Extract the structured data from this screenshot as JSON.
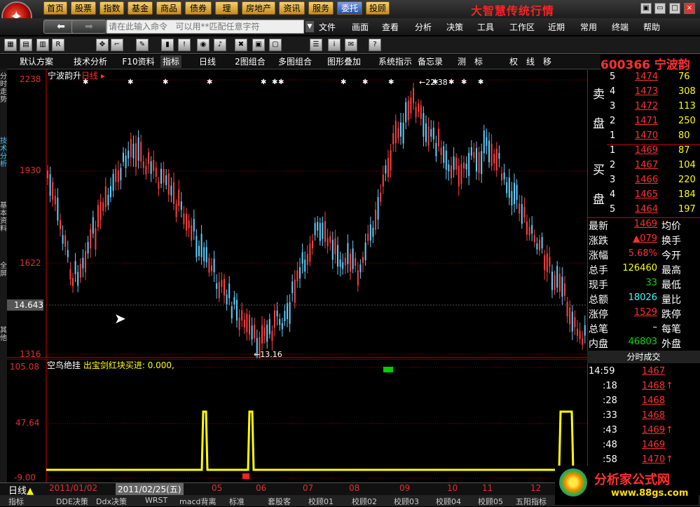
{
  "app": {
    "title": "大智慧传统行情",
    "nav": [
      "首页",
      "股票",
      "指数",
      "基金",
      "商品",
      "债券",
      "理财",
      "房地产",
      "资讯",
      "服务",
      "委托",
      "投顾"
    ],
    "command_placeholder": "请在此输入命令   可以用**匹配任意字符",
    "menus": [
      "文件",
      "画面",
      "查看",
      "分析",
      "决策",
      "工具",
      "工作区",
      "近期",
      "常用",
      "终端",
      "帮助"
    ]
  },
  "tabs": [
    "默认方案",
    "技术分析",
    "F10资料",
    "指标",
    "日线",
    "2图组合",
    "多图组合",
    "图形叠加",
    "系统指示",
    "备忘录",
    "测",
    "标",
    "权",
    "线",
    "移"
  ],
  "left_tabs": [
    "分时走势",
    "技术分析",
    "基本资料",
    "全屏",
    "其他"
  ],
  "stock": {
    "code": "600366",
    "name": "宁波韵升",
    "period": "日线"
  },
  "main_chart": {
    "y_labels": [
      "2238",
      "1930",
      "1622",
      "14.643",
      "1316"
    ],
    "annotations": {
      "high": "22.38",
      "low": "13.16"
    }
  },
  "indicator": {
    "name": "空鸟绝挂",
    "text": "出宝剑红块买进: 0.000,",
    "y_labels": [
      "105.08",
      "47.64",
      "-9.00"
    ]
  },
  "x_axis": {
    "start": "2011/01/02",
    "cursor": "2011/02/25(五)",
    "months": [
      "05",
      "06",
      "07",
      "08",
      "09",
      "10",
      "11",
      "12"
    ]
  },
  "order_book": {
    "sell_label": [
      "卖",
      "盘"
    ],
    "buy_label": [
      "买",
      "盘"
    ],
    "sell": [
      {
        "lvl": "5",
        "price": "1474",
        "vol": "76"
      },
      {
        "lvl": "4",
        "price": "1473",
        "vol": "308"
      },
      {
        "lvl": "3",
        "price": "1472",
        "vol": "113"
      },
      {
        "lvl": "2",
        "price": "1471",
        "vol": "250"
      },
      {
        "lvl": "1",
        "price": "1470",
        "vol": "80"
      }
    ],
    "buy": [
      {
        "lvl": "1",
        "price": "1469",
        "vol": "87"
      },
      {
        "lvl": "2",
        "price": "1467",
        "vol": "104"
      },
      {
        "lvl": "3",
        "price": "1466",
        "vol": "220"
      },
      {
        "lvl": "4",
        "price": "1465",
        "vol": "184"
      },
      {
        "lvl": "5",
        "price": "1464",
        "vol": "197"
      }
    ]
  },
  "stats": [
    {
      "label": "最新",
      "value": "1469",
      "label2": "均价"
    },
    {
      "label": "涨跌",
      "value": "▲079",
      "label2": "换手"
    },
    {
      "label": "涨幅",
      "value": "5.68%",
      "label2": "今开"
    },
    {
      "label": "总手",
      "value": "126460",
      "label2": "最高"
    },
    {
      "label": "现手",
      "value": "33",
      "label2": "最低"
    },
    {
      "label": "总额",
      "value": "18026",
      "label2": "量比"
    },
    {
      "label": "涨停",
      "value": "1529",
      "label2": "跌停"
    },
    {
      "label": "总笔",
      "value": "–",
      "label2": "每笔"
    },
    {
      "label": "内盘",
      "value": "46803",
      "label2": "外盘"
    }
  ],
  "ticks_title": "分时成交",
  "ticks": [
    {
      "time": "14:59",
      "price": "1467",
      "arrow": ""
    },
    {
      "time": ":18",
      "price": "1468",
      "arrow": "↑"
    },
    {
      "time": ":28",
      "price": "1468",
      "arrow": ""
    },
    {
      "time": ":33",
      "price": "1468",
      "arrow": ""
    },
    {
      "time": ":43",
      "price": "1469",
      "arrow": "↑"
    },
    {
      "time": ":48",
      "price": "1469",
      "arrow": ""
    },
    {
      "time": ":58",
      "price": "1470",
      "arrow": "↑"
    }
  ],
  "bottom_period": "日线",
  "bottom_tabs": [
    "指标",
    "DDE决策",
    "Ddx决策",
    "WRST",
    "macd背离",
    "标准",
    "套股客",
    "校顾01",
    "校顾02",
    "校顾03",
    "校顾04",
    "校顾05",
    "五阳指标"
  ],
  "watermark": {
    "name": "分析家公式网",
    "url": "www.88gs.com"
  },
  "colors": {
    "up": "#ff3030",
    "down": "#40c8ff",
    "indicator": "#ffff00",
    "accent": "#ff3030"
  }
}
